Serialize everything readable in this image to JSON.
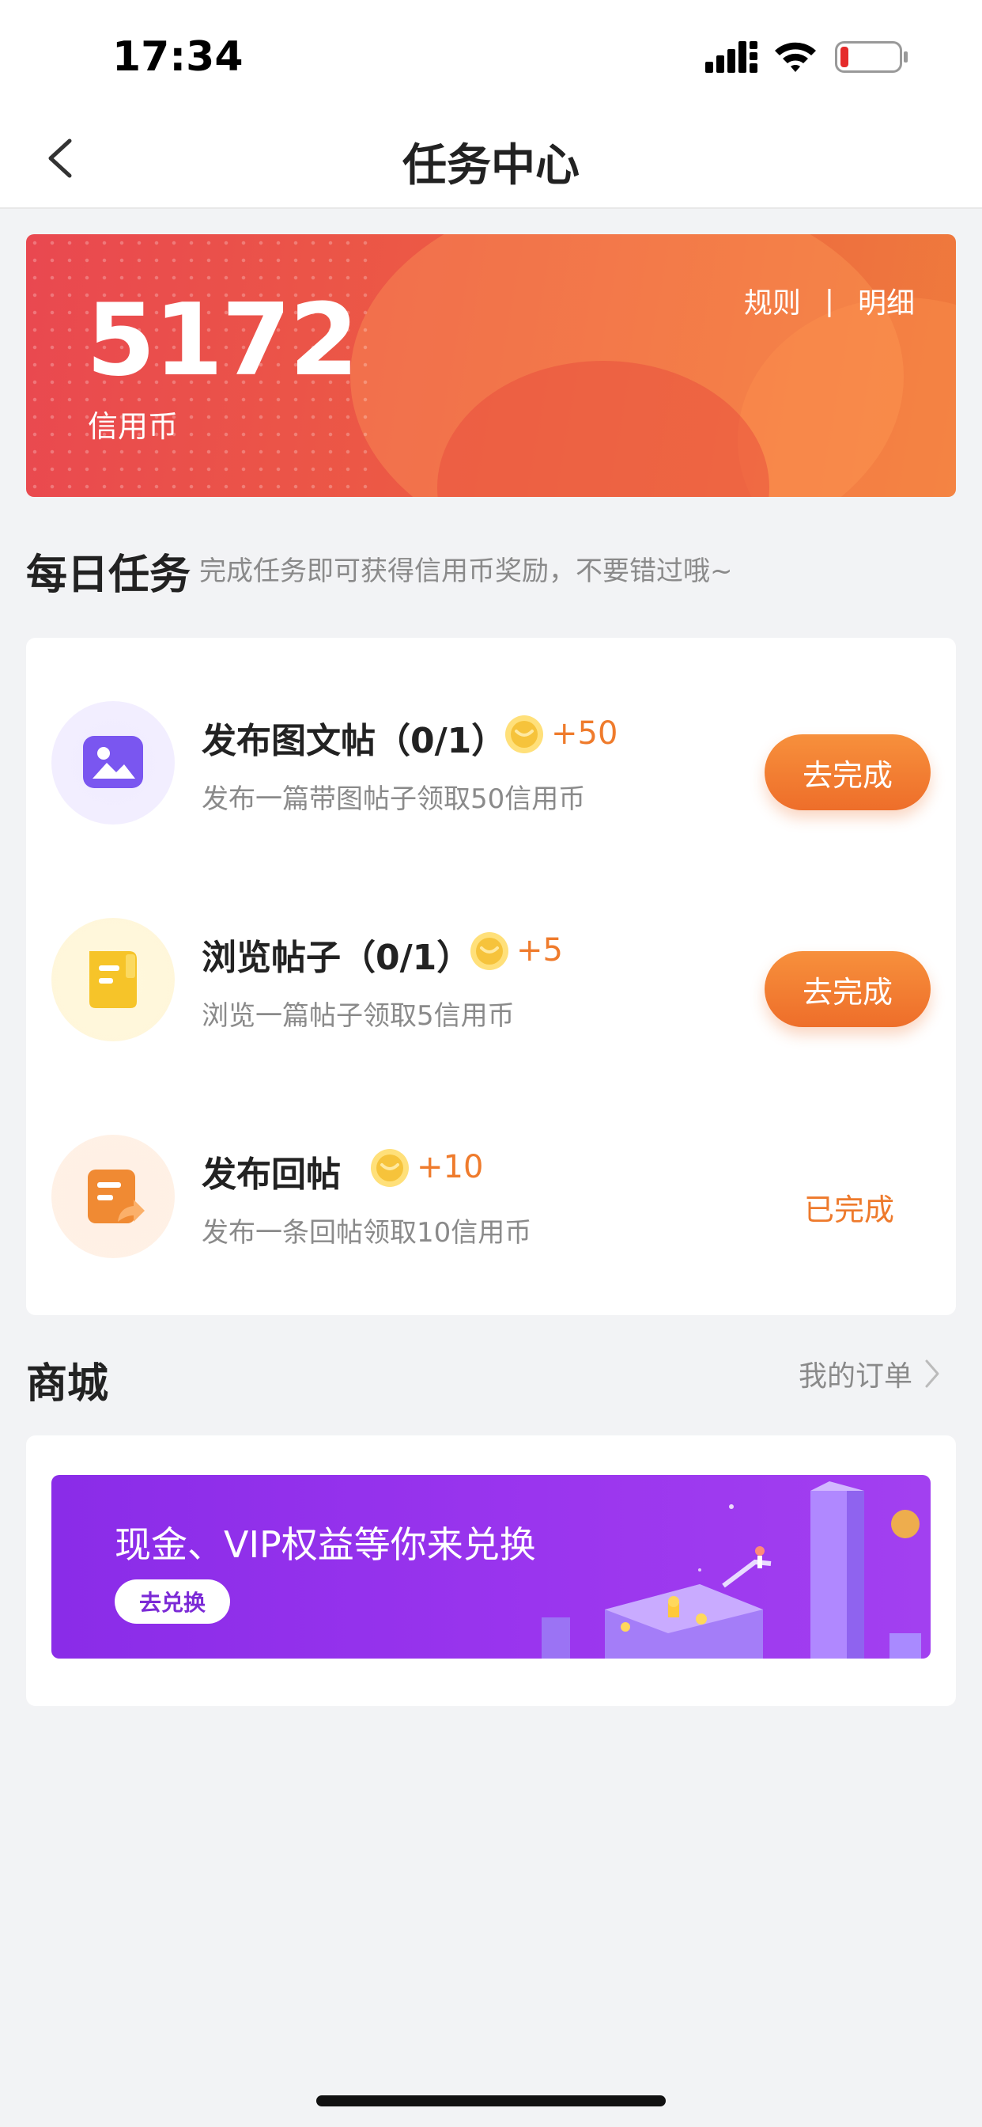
{
  "status_bar": {
    "time": "17:34"
  },
  "nav": {
    "title": "任务中心"
  },
  "credits": {
    "value": "5172",
    "unit": "信用币",
    "rules_label": "规则",
    "separator": "|",
    "detail_label": "明细"
  },
  "daily": {
    "title": "每日任务",
    "subtitle": "完成任务即可获得信用币奖励，不要错过哦~",
    "tasks": [
      {
        "title": "发布图文帖（0/1）",
        "reward": "+50",
        "desc": "发布一篇带图帖子领取50信用币",
        "action": "去完成",
        "icon": "image-icon",
        "accent": "#7a56f0"
      },
      {
        "title": "浏览帖子（0/1）",
        "reward": "+5",
        "desc": "浏览一篇帖子领取5信用币",
        "action": "去完成",
        "icon": "document-icon",
        "accent": "#f6c429"
      },
      {
        "title": "发布回帖",
        "reward": "+10",
        "desc": "发布一条回帖领取10信用币",
        "action": "已完成",
        "icon": "reply-icon",
        "accent": "#f08a33"
      }
    ]
  },
  "mall": {
    "title": "商城",
    "orders_label": "我的订单",
    "promo_text": "现金、VIP权益等你来兑换",
    "promo_button": "去兑换"
  },
  "colors": {
    "brand_orange": "#ee6e2a",
    "banner_red": "#e94850",
    "promo_purple": "#8a2ce8"
  }
}
